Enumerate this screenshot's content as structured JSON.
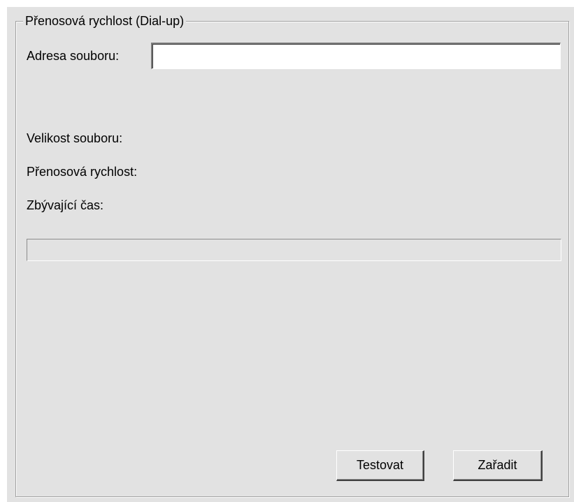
{
  "group": {
    "title": "Přenosová rychlost (Dial-up)"
  },
  "form": {
    "file_address_label": "Adresa souboru:",
    "file_address_value": "",
    "file_size_label": "Velikost souboru:",
    "transfer_rate_label": "Přenosová rychlost:",
    "remaining_time_label": "Zbývající čas:",
    "progress_value": 0
  },
  "buttons": {
    "test_label": "Testovat",
    "queue_label": "Zařadit"
  },
  "colors": {
    "panel_background": "#e2e2e2",
    "progress_fill": "#0a246a"
  }
}
